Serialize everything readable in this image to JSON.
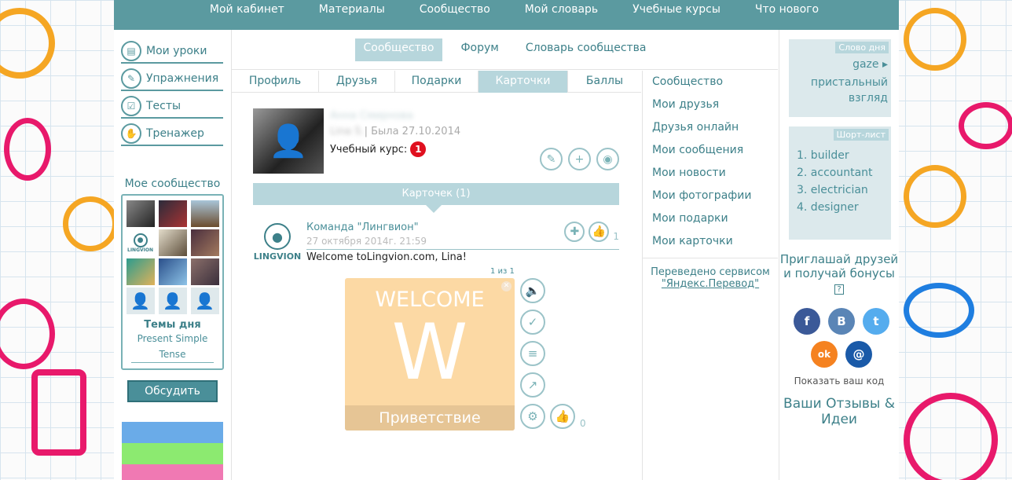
{
  "colors": {
    "accent": "#5b9aa0",
    "accent_light": "#b7d6dc",
    "card_bg": "#fcd9a4",
    "card_footer": "#e6c595",
    "badge": "#e0101f",
    "stripe_1": "#6aabe8",
    "stripe_2": "#8cea70",
    "stripe_3": "#f079b3",
    "facebook": "#3b5998",
    "vk": "#5a85b6",
    "twitter": "#55acee",
    "odnoklassniki": "#f58220",
    "mailru": "#1a5aa8"
  },
  "topnav": [
    "Мой кабинет",
    "Материалы",
    "Сообщество",
    "Мой словарь",
    "Учебные курсы",
    "Что нового"
  ],
  "left": {
    "lessons": [
      {
        "label": "Мои уроки",
        "icon": "book-icon"
      },
      {
        "label": "Упражнения",
        "icon": "pencil-icon"
      },
      {
        "label": "Тесты",
        "icon": "checklist-icon"
      },
      {
        "label": "Тренажер",
        "icon": "hand-icon"
      }
    ],
    "community_title": "Мое сообщество",
    "lingvion_label": "LINGVION",
    "topics_title": "Темы дня",
    "topics_link": "Present Simple Tense",
    "discuss_btn": "Обсудить"
  },
  "subtabs": [
    "Сообщество",
    "Форум",
    "Словарь сообщества"
  ],
  "cardtabs": [
    "Профиль",
    "Друзья",
    "Подарки",
    "Карточки",
    "Баллы"
  ],
  "profile": {
    "name": "Анна Смирнова",
    "seen_prefix": "Lina S.",
    "seen": "| Была 27.10.2014",
    "course_label": "Учебный курс:",
    "course_count": "1"
  },
  "cards_bar": "Карточек (1)",
  "post": {
    "author": "Команда \"Лингвион\"",
    "date": "27 октября 2014г. 21:59",
    "text": "Welcome toLingvion.com, Lina!",
    "logo_label": "LINGVION",
    "like_count": "1"
  },
  "flashcard": {
    "pager": "1 из 1",
    "heading": "WELCOME",
    "letter": "W",
    "footer": "Приветствие",
    "like_count": "0"
  },
  "community_links": [
    "Сообщество",
    "Мои друзья",
    "Друзья онлайн",
    "Мои сообщения",
    "Мои новости",
    "Мои фотографии",
    "Мои подарки",
    "Мои карточки"
  ],
  "translated_by": "Переведено сервисом",
  "translated_link": "\"Яндекс.Перевод\"",
  "word_of_day": {
    "label": "Слово дня",
    "word": "gaze",
    "translation": "пристальный взгляд"
  },
  "shortlist": {
    "label": "Шорт-лист",
    "items": [
      "1. builder",
      "2. accountant",
      "3. electrician",
      "4. designer"
    ]
  },
  "invite": "Приглашай друзей и получай бонусы",
  "invite_help": "?",
  "socials": {
    "facebook": "f",
    "vk": "B",
    "twitter": "t",
    "odnoklassniki": "ok",
    "mailru": "@"
  },
  "show_code": "Показать ваш код",
  "reviews": "Ваши Отзывы & Идеи"
}
